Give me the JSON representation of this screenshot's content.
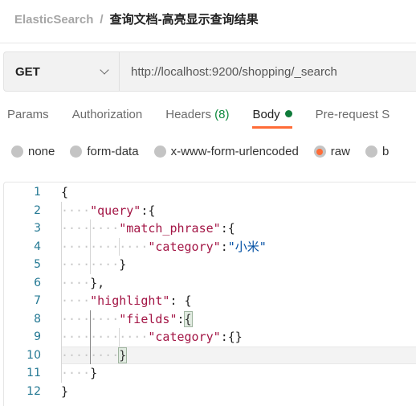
{
  "breadcrumb": {
    "parent": "ElasticSearch",
    "separator": "/",
    "current": "查询文档-高亮显示查询结果"
  },
  "request": {
    "method": "GET",
    "url": "http://localhost:9200/shopping/_search"
  },
  "tabs": [
    {
      "label": "Params"
    },
    {
      "label": "Authorization"
    },
    {
      "label": "Headers",
      "count": "(8)"
    },
    {
      "label": "Body",
      "active": true
    },
    {
      "label": "Pre-request S"
    }
  ],
  "body_types": [
    {
      "label": "none"
    },
    {
      "label": "form-data"
    },
    {
      "label": "x-www-form-urlencoded"
    },
    {
      "label": "raw",
      "selected": true
    },
    {
      "label": "b"
    }
  ],
  "editor": {
    "lines": [
      {
        "n": "1",
        "indent": 0,
        "parts": [
          [
            "b",
            "{"
          ]
        ]
      },
      {
        "n": "2",
        "indent": 1,
        "parts": [
          [
            "k",
            "\"query\""
          ],
          [
            "b",
            ":{"
          ]
        ]
      },
      {
        "n": "3",
        "indent": 2,
        "parts": [
          [
            "k",
            "\"match_phrase\""
          ],
          [
            "b",
            ":{"
          ]
        ]
      },
      {
        "n": "4",
        "indent": 3,
        "parts": [
          [
            "k",
            "\"category\""
          ],
          [
            "b",
            ":"
          ],
          [
            "s",
            "\"小米\""
          ]
        ]
      },
      {
        "n": "5",
        "indent": 2,
        "parts": [
          [
            "b",
            "}"
          ]
        ]
      },
      {
        "n": "6",
        "indent": 1,
        "parts": [
          [
            "b",
            "},"
          ]
        ]
      },
      {
        "n": "7",
        "indent": 1,
        "parts": [
          [
            "k",
            "\"highlight\""
          ],
          [
            "b",
            ": {"
          ]
        ]
      },
      {
        "n": "8",
        "indent": 2,
        "parts": [
          [
            "k",
            "\"fields\""
          ],
          [
            "b",
            ":"
          ],
          [
            "mb",
            "{"
          ]
        ]
      },
      {
        "n": "9",
        "indent": 3,
        "parts": [
          [
            "k",
            "\"category\""
          ],
          [
            "b",
            ":{}"
          ]
        ]
      },
      {
        "n": "10",
        "indent": 2,
        "parts": [
          [
            "mb",
            "}"
          ]
        ],
        "current": true
      },
      {
        "n": "11",
        "indent": 1,
        "parts": [
          [
            "b",
            "}"
          ]
        ]
      },
      {
        "n": "12",
        "indent": 0,
        "parts": [
          [
            "b",
            "}"
          ]
        ]
      }
    ]
  },
  "colors": {
    "accent": "#ff6c37",
    "body_dot": "#0f7b3a",
    "count": "#0f8a3e",
    "key": "#a31545",
    "string": "#0451a5",
    "line_number": "#237893"
  }
}
